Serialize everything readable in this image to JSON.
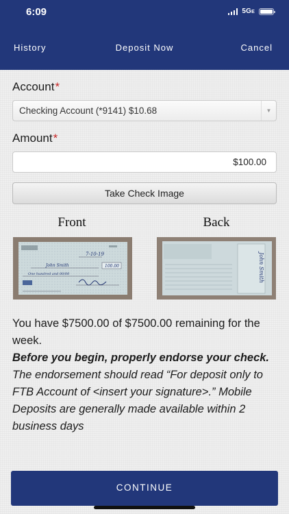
{
  "status": {
    "time": "6:09",
    "network": "5G",
    "network_suffix": "E"
  },
  "nav": {
    "history": "History",
    "title": "Deposit Now",
    "cancel": "Cancel"
  },
  "form": {
    "account_label": "Account",
    "account_required": "*",
    "account_value": "Checking Account (*9141) $10.68",
    "amount_label": "Amount",
    "amount_required": "*",
    "amount_value": "$100.00",
    "take_image_label": "Take Check Image"
  },
  "images": {
    "front_label": "Front",
    "back_label": "Back"
  },
  "check_front": {
    "date": "7-10-19",
    "payee": "John Smith",
    "amount": "100.00",
    "words": "One hundred and 00/00"
  },
  "check_back": {
    "signature": "John Smith"
  },
  "info": {
    "remaining_text": "You have $7500.00 of $7500.00 remaining for the week.",
    "bold_lead": "Before you begin, properly endorse your check.",
    "endorse_text": " The endorsement should read “For deposit only to FTB Account of <insert your signature>.” Mobile Deposits are generally made available within 2 business days"
  },
  "actions": {
    "continue": "CONTINUE"
  },
  "colors": {
    "brand_navy": "#22377a",
    "required_red": "#c62828",
    "background": "#efefef"
  }
}
